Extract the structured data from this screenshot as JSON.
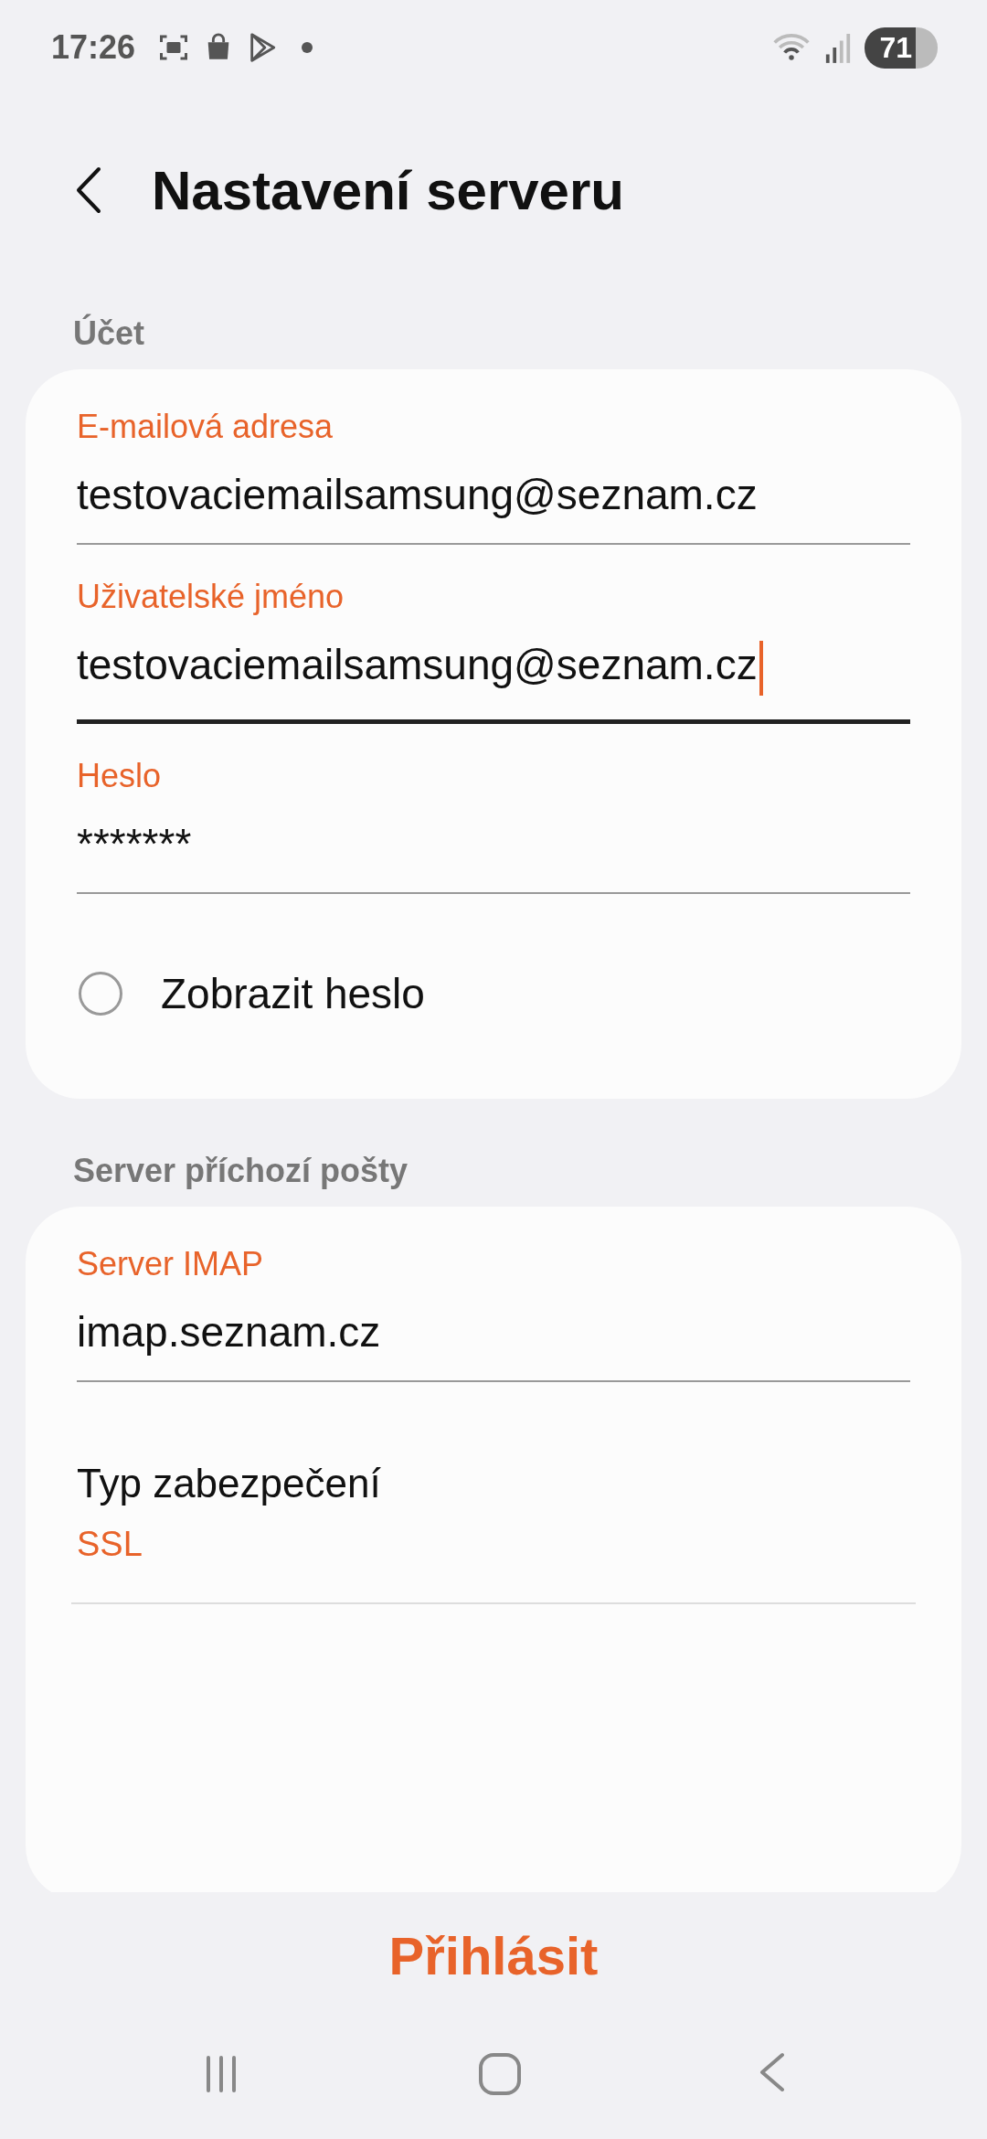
{
  "status_bar": {
    "time": "17:26",
    "battery": "71"
  },
  "header": {
    "title": "Nastavení serveru"
  },
  "sections": [
    {
      "title": "Účet",
      "items": [
        {
          "kind": "field",
          "label": "E-mailová adresa",
          "value": "testovaciemailsamsung@seznam.cz",
          "focused": false
        },
        {
          "kind": "field",
          "label": "Uživatelské jméno",
          "value": "testovaciemailsamsung@seznam.cz",
          "focused": true
        },
        {
          "kind": "field",
          "label": "Heslo",
          "value": "*******",
          "focused": false
        },
        {
          "kind": "checkbox",
          "label": "Zobrazit heslo",
          "checked": false
        }
      ]
    },
    {
      "title": "Server příchozí pošty",
      "items": [
        {
          "kind": "field",
          "label": "Server IMAP",
          "value": "imap.seznam.cz",
          "focused": false
        },
        {
          "kind": "setting",
          "label": "Typ zabezpečení",
          "value": "SSL"
        }
      ]
    }
  ],
  "login_button": "Přihlásit"
}
